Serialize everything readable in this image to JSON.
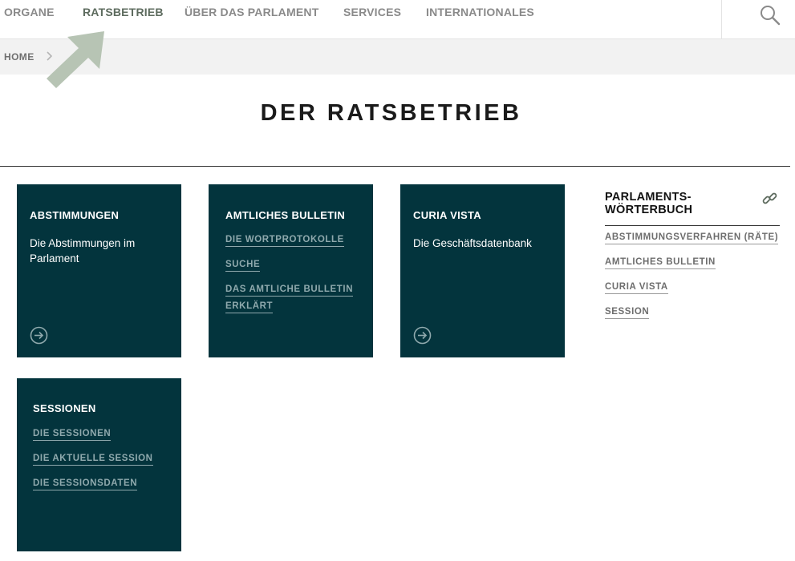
{
  "nav": {
    "items": [
      "ORGANE",
      "RATSBETRIEB",
      "ÜBER DAS PARLAMENT",
      "SERVICES",
      "INTERNATIONALES"
    ],
    "active": "RATSBETRIEB"
  },
  "breadcrumb": {
    "home": "HOME"
  },
  "page": {
    "title": "DER RATSBETRIEB"
  },
  "tiles": {
    "abstimmungen": {
      "title": "ABSTIMMUNGEN",
      "desc_line1": "Die Abstimmungen im",
      "desc_line2": "Parlament"
    },
    "bulletin": {
      "title": "AMTLICHES BULLETIN",
      "links": [
        "DIE WORTPROTOKOLLE",
        "SUCHE"
      ],
      "link3_line1": "DAS AMTLICHE BULLETIN",
      "link3_line2": "ERKLÄRT"
    },
    "curia": {
      "title": "CURIA VISTA",
      "desc": "Die Geschäftsdatenbank"
    },
    "sessionen": {
      "title": "SESSIONEN",
      "links": [
        "DIE SESSIONEN",
        "DIE AKTUELLE SESSION",
        "DIE SESSIONSDATEN"
      ]
    }
  },
  "sidebar": {
    "title_line1": "PARLAMENTS-",
    "title_line2": "WÖRTERBUCH",
    "links": [
      "ABSTIMMUNGSVERFAHREN (RÄTE)",
      "AMTLICHES BULLETIN",
      "CURIA VISTA",
      "SESSION"
    ]
  },
  "colors": {
    "tile_bg": "#03343d",
    "tile_link": "#8fa9ad",
    "hint_arrow": "#b7c4b4",
    "active_nav": "#5d6b5e"
  },
  "icons": {
    "search": "search-icon",
    "breadcrumb_sep": "chevron-right-icon",
    "tile_arrow": "circle-arrow-right-icon",
    "glossary": "link-icon",
    "hint": "pointer-arrow-icon"
  }
}
